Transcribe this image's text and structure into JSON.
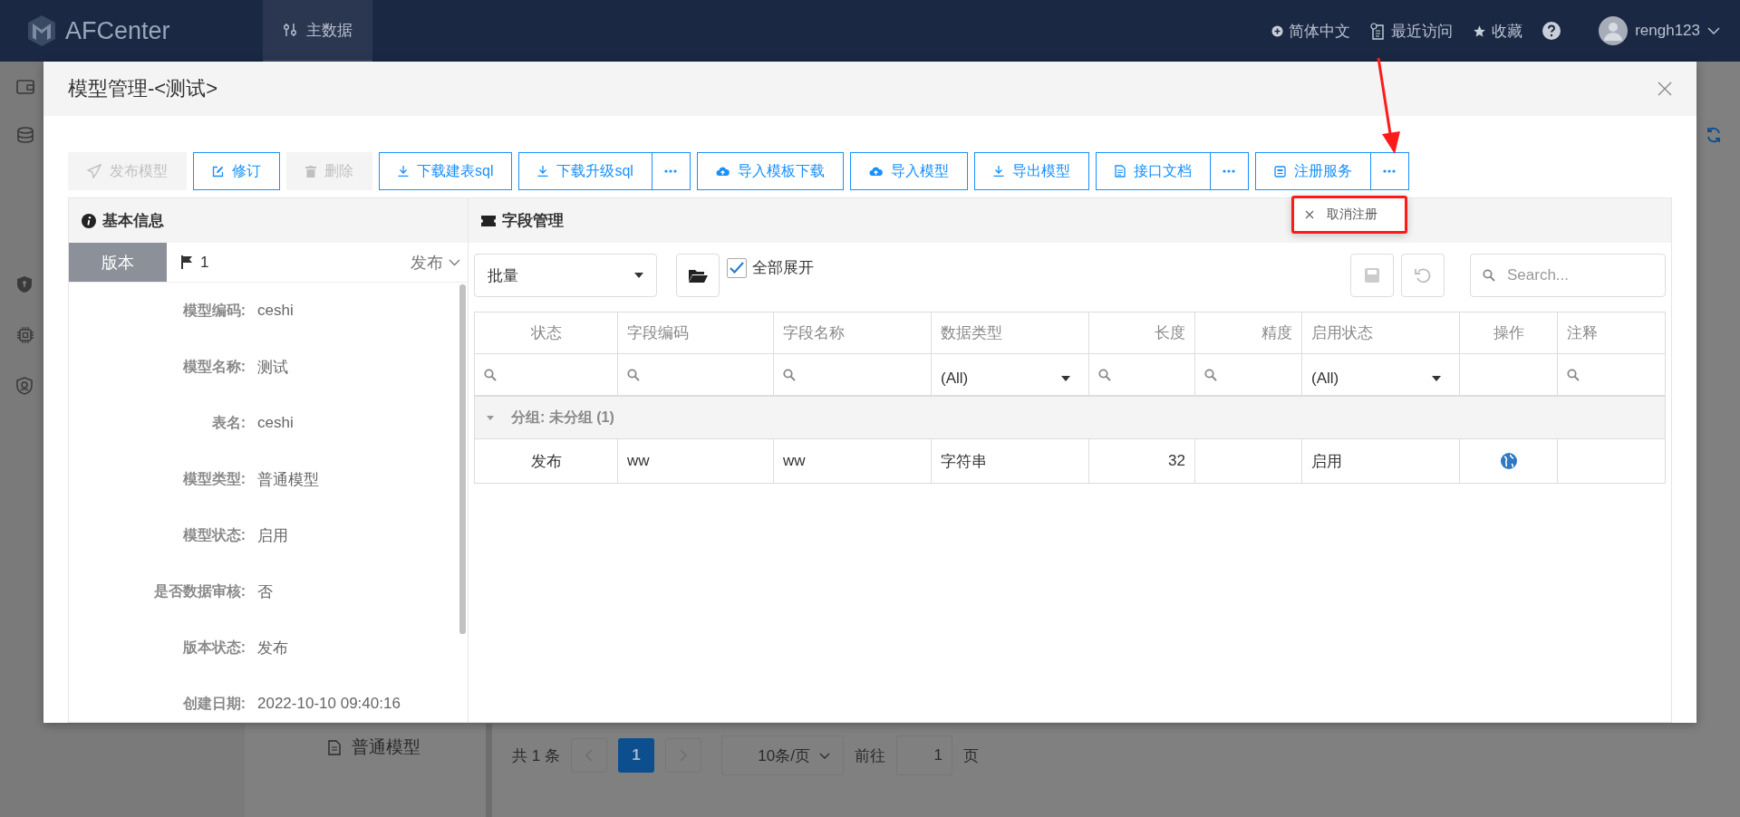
{
  "header": {
    "logo": "AFCenter",
    "nav": [
      {
        "label": "主数据",
        "selected": true
      }
    ],
    "actions": [
      {
        "kind": "language",
        "label": "简体中文"
      },
      {
        "kind": "recent",
        "label": "最近访问"
      },
      {
        "kind": "favorite",
        "label": "收藏"
      },
      {
        "kind": "help"
      }
    ],
    "user": "rengh123"
  },
  "background": {
    "sidebar": [
      {
        "kind": "wallet"
      },
      {
        "kind": "database"
      },
      {
        "kind": "shield"
      },
      {
        "kind": "chip"
      },
      {
        "kind": "security"
      }
    ],
    "tree_item": "普通模型",
    "pagination": {
      "total": "共 1 条",
      "pages": [
        {
          "label": "1",
          "selected": true
        }
      ],
      "page_size": "10条/页",
      "goto_label": "前往",
      "goto_value": "1",
      "goto_suffix": "页"
    }
  },
  "modal": {
    "title": "模型管理-<测试>",
    "toolbar": [
      {
        "label": "发布模型",
        "kind": "publish",
        "disabled": true,
        "split": false
      },
      {
        "label": "修订",
        "kind": "edit",
        "disabled": false,
        "split": false
      },
      {
        "label": "删除",
        "kind": "delete",
        "disabled": true,
        "split": false
      },
      {
        "label": "下载建表sql",
        "kind": "download",
        "disabled": false,
        "split": false
      },
      {
        "label": "下载升级sql",
        "kind": "download",
        "disabled": false,
        "split": true
      },
      {
        "label": "导入模板下载",
        "kind": "upload",
        "disabled": false,
        "split": false
      },
      {
        "label": "导入模型",
        "kind": "upload",
        "disabled": false,
        "split": false
      },
      {
        "label": "导出模型",
        "kind": "download",
        "disabled": false,
        "split": false
      },
      {
        "label": "接口文档",
        "kind": "document",
        "disabled": false,
        "split": true
      },
      {
        "label": "注册服务",
        "kind": "service",
        "disabled": false,
        "split": true
      }
    ],
    "dropdown": {
      "highlighted": true,
      "items": [
        {
          "label": "取消注册"
        }
      ]
    },
    "basic_info": {
      "title": "基本信息",
      "version": {
        "tab": "版本",
        "number": "1",
        "status": "发布"
      },
      "fields": [
        {
          "label": "模型编码:",
          "value": "ceshi"
        },
        {
          "label": "模型名称:",
          "value": "测试"
        },
        {
          "label": "表名:",
          "value": "ceshi"
        },
        {
          "label": "模型类型:",
          "value": "普通模型"
        },
        {
          "label": "模型状态:",
          "value": "启用"
        },
        {
          "label": "是否数据审核:",
          "value": "否"
        },
        {
          "label": "版本状态:",
          "value": "发布"
        },
        {
          "label": "创建日期:",
          "value": "2022-10-10 09:40:16"
        }
      ]
    },
    "field_management": {
      "title": "字段管理",
      "batch_select": "批量",
      "expand_all": {
        "label": "全部展开",
        "checked": true
      },
      "search": {
        "placeholder": "Search..."
      },
      "columns": [
        {
          "label": "状态"
        },
        {
          "label": "字段编码"
        },
        {
          "label": "字段名称"
        },
        {
          "label": "数据类型"
        },
        {
          "label": "长度"
        },
        {
          "label": "精度"
        },
        {
          "label": "启用状态"
        },
        {
          "label": "操作"
        },
        {
          "label": "注释"
        }
      ],
      "filters": [
        {
          "kind": "search"
        },
        {
          "kind": "search"
        },
        {
          "kind": "search"
        },
        {
          "kind": "select",
          "value": "(All)"
        },
        {
          "kind": "search"
        },
        {
          "kind": "search"
        },
        {
          "kind": "select",
          "value": "(All)"
        },
        {
          "kind": "empty"
        },
        {
          "kind": "search"
        }
      ],
      "group": {
        "label": "分组: 未分组 (1)",
        "expanded": true
      },
      "rows": [
        {
          "cells": [
            {
              "kind": "text",
              "text": "发布"
            },
            {
              "kind": "text",
              "text": "ww"
            },
            {
              "kind": "text",
              "text": "ww"
            },
            {
              "kind": "text",
              "text": "字符串"
            },
            {
              "kind": "text",
              "text": "32"
            },
            {
              "kind": "empty"
            },
            {
              "kind": "text",
              "text": "启用"
            },
            {
              "kind": "globe"
            },
            {
              "kind": "empty"
            }
          ]
        }
      ]
    }
  },
  "annotation": {
    "arrow": true
  }
}
